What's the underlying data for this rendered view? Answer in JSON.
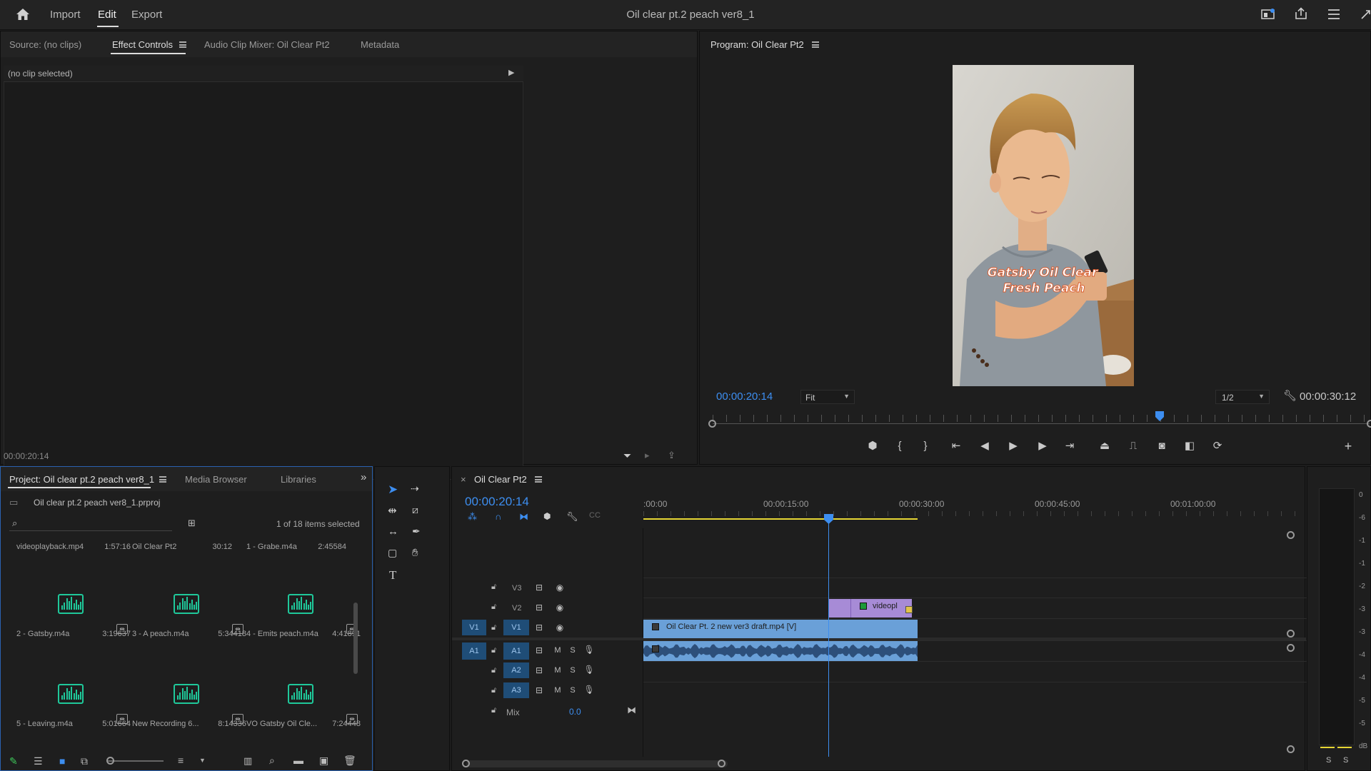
{
  "topbar": {
    "home_icon": "home-icon",
    "nav": [
      "Import",
      "Edit",
      "Export"
    ],
    "active": "Edit",
    "title": "Oil clear pt.2 peach ver8_1"
  },
  "source_panel": {
    "tabs": [
      "Source: (no clips)",
      "Effect Controls",
      "Audio Clip Mixer: Oil Clear Pt2",
      "Metadata"
    ],
    "active_tab": "Effect Controls",
    "no_clip": "(no clip selected)",
    "timecode": "00:00:20:14"
  },
  "program_panel": {
    "title": "Program: Oil Clear Pt2",
    "caption_line1": "Gatsby Oil Clear",
    "caption_line2": "Fresh Peach",
    "timecode": "00:00:20:14",
    "fit": "Fit",
    "resolution": "1/2",
    "duration": "00:00:30:12",
    "playhead_fraction": 0.68
  },
  "project_panel": {
    "tabs": [
      "Project: Oil clear pt.2 peach ver8_1",
      "Media Browser",
      "Libraries"
    ],
    "file": "Oil clear pt.2 peach ver8_1.prproj",
    "selected_count": "1 of 18 items selected",
    "top_row": [
      {
        "name": "videoplayback.mp4",
        "dur": "1:57:16"
      },
      {
        "name": "Oil Clear Pt2",
        "dur": "30:12"
      },
      {
        "name": "1 - Grabe.m4a",
        "dur": "2:45584"
      }
    ],
    "items": [
      {
        "name": "2 - Gatsby.m4a",
        "dur": "3:19637"
      },
      {
        "name": "3 - A peach.m4a",
        "dur": "5:34418"
      },
      {
        "name": "4 - Emits peach.m4a",
        "dur": "4:41891"
      },
      {
        "name": "5 - Leaving.m4a",
        "dur": "5:01664"
      },
      {
        "name": "New Recording 6...",
        "dur": "8:14336"
      },
      {
        "name": "VO Gatsby Oil Cle...",
        "dur": "7:24448"
      }
    ]
  },
  "timeline": {
    "sequence": "Oil Clear Pt2",
    "timecode": "00:00:20:14",
    "ruler": [
      ":00:00",
      "00:00:15:00",
      "00:00:30:00",
      "00:00:45:00",
      "00:01:00:00"
    ],
    "tracks_video": [
      "V3",
      "V2",
      "V1"
    ],
    "tracks_audio": [
      "A1",
      "A2",
      "A3"
    ],
    "source_v": "V1",
    "source_a": "A1",
    "mix_label": "Mix",
    "mix_value": "0.0",
    "clip_v1": "Oil Clear Pt. 2 new ver3 draft.mp4 [V]",
    "clip_v2": "videopl",
    "track_m": "M",
    "track_s": "S"
  },
  "meter": {
    "scale": [
      "0",
      "-6",
      "-1",
      "-1",
      "-2",
      "-3",
      "-3",
      "-4",
      "-4",
      "-5",
      "-5",
      "dB"
    ],
    "solo": [
      "S",
      "S"
    ]
  },
  "colors": {
    "accent": "#3d8ef0",
    "clip_video": "#6aa0d8",
    "clip_v2": "#a78bd6",
    "audio_icon": "#1fc89a",
    "work_area": "#e6d634"
  }
}
